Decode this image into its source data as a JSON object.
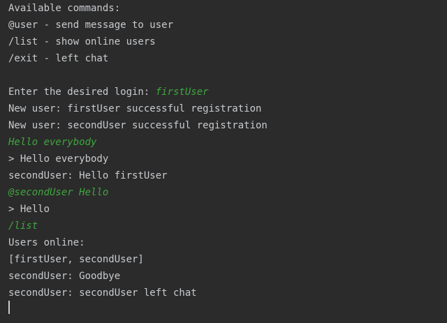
{
  "colors": {
    "background": "#2b2b2b",
    "output_text": "#c8cbcf",
    "user_input_text": "#3fa63f"
  },
  "console": {
    "lines": [
      {
        "text": "Available commands:"
      },
      {
        "text": "@user - send message to user"
      },
      {
        "text": "/list - show online users"
      },
      {
        "text": "/exit - left chat"
      },
      {
        "text": ""
      },
      {
        "prefix": "Enter the desired login: ",
        "input": "firstUser"
      },
      {
        "text": "New user: firstUser successful registration"
      },
      {
        "text": "New user: secondUser successful registration"
      },
      {
        "input": "Hello everybody"
      },
      {
        "text": "> Hello everybody"
      },
      {
        "text": "secondUser: Hello firstUser"
      },
      {
        "input": "@secondUser Hello"
      },
      {
        "text": "> Hello"
      },
      {
        "input": "/list"
      },
      {
        "text": "Users online:"
      },
      {
        "text": "[firstUser, secondUser]"
      },
      {
        "text": "secondUser: Goodbye"
      },
      {
        "text": "secondUser: secondUser left chat"
      }
    ]
  }
}
